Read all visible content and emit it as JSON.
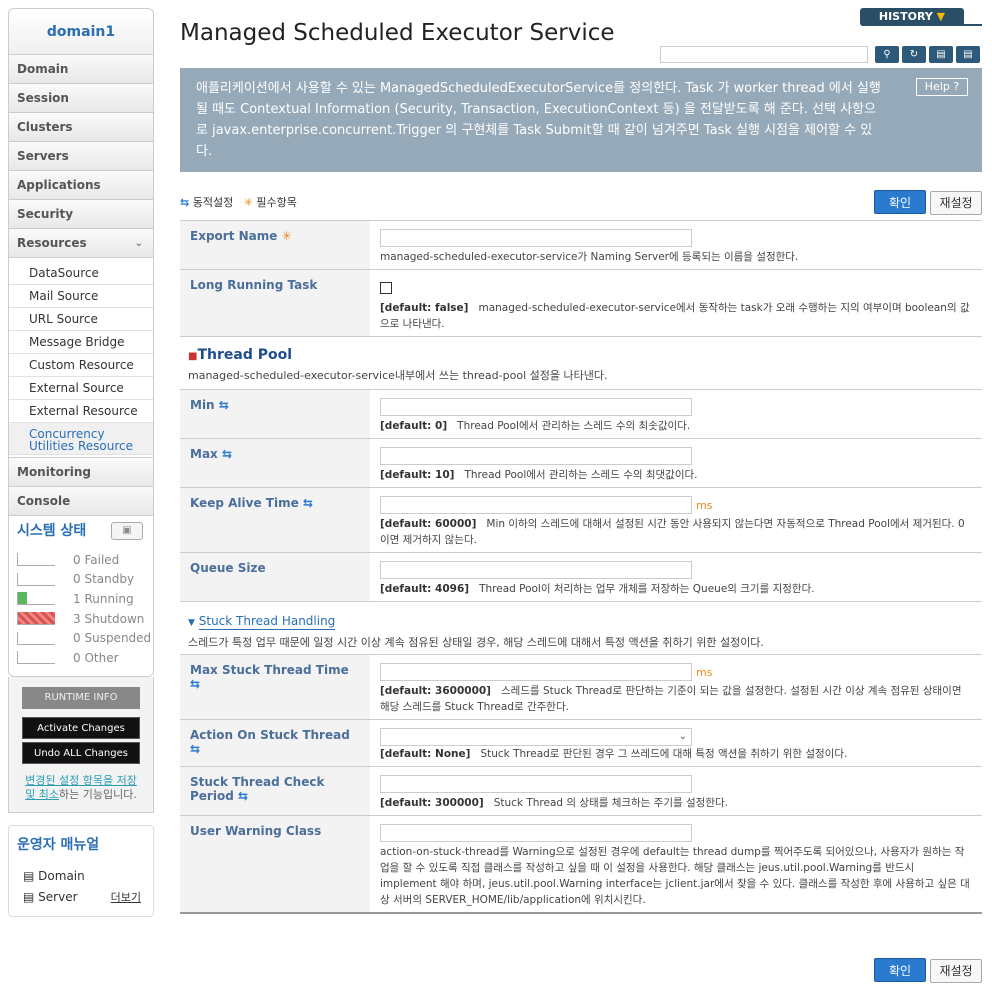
{
  "sidebar": {
    "domain": "domain1",
    "nav": [
      "Domain",
      "Session",
      "Clusters",
      "Servers",
      "Applications",
      "Security"
    ],
    "resources": "Resources",
    "sub": [
      "DataSource",
      "Mail Source",
      "URL Source",
      "Message Bridge",
      "Custom Resource",
      "External Source",
      "External Resource",
      "Concurrency Utilities Resource"
    ],
    "monitoring": "Monitoring",
    "console": "Console",
    "status_title": "시스템 상태",
    "status": [
      {
        "count": "0",
        "label": "Failed"
      },
      {
        "count": "0",
        "label": "Standby"
      },
      {
        "count": "1",
        "label": "Running"
      },
      {
        "count": "3",
        "label": "Shutdown"
      },
      {
        "count": "0",
        "label": "Suspended"
      },
      {
        "count": "0",
        "label": "Other"
      }
    ],
    "runtime_info": "RUNTIME INFO",
    "activate": "Activate Changes",
    "undo": "Undo ALL Changes",
    "note_link": "변경된 설정 항목을 저장 및 최소",
    "note_rest": "하는 기능입니다.",
    "manual_title": "운영자 매뉴얼",
    "manual_items": [
      "Domain",
      "Server"
    ],
    "more": "더보기"
  },
  "main": {
    "title": "Managed Scheduled Executor Service",
    "history": "HISTORY",
    "description": "애플리케이션에서 사용할 수 있는 ManagedScheduledExecutorService를 정의한다. Task 가 worker thread 에서 실행될 때도 Contextual Information (Security, Transaction, ExecutionContext 등) 을 전달받도록 해 준다. 선택 사항으로 javax.enterprise.concurrent.Trigger 의 구현체를 Task Submit할 때 같이 넘겨주면 Task 실행 시점을 제어할 수 있다.",
    "help": "Help",
    "legend_dynamic": "동적설정",
    "legend_required": "필수항목",
    "ok": "확인",
    "reset": "재설정"
  },
  "form": {
    "export_name": {
      "label": "Export Name",
      "desc": "managed-scheduled-executor-service가 Naming Server에 등록되는 이름을 설정한다."
    },
    "long_running": {
      "label": "Long Running Task",
      "default": "[default: false]",
      "desc": "managed-scheduled-executor-service에서 동작하는 task가 오래 수행하는 지의 여부이며 boolean의 값으로 나타낸다."
    },
    "thread_pool": {
      "title": "Thread Pool",
      "desc": "managed-scheduled-executor-service내부에서 쓰는 thread-pool 설정을 나타낸다."
    },
    "min": {
      "label": "Min",
      "default": "[default: 0]",
      "desc": "Thread Pool에서 관리하는 스레드 수의 최솟값이다."
    },
    "max": {
      "label": "Max",
      "default": "[default: 10]",
      "desc": "Thread Pool에서 관리하는 스레드 수의 최댓값이다."
    },
    "keep_alive": {
      "label": "Keep Alive Time",
      "unit": "ms",
      "default": "[default: 60000]",
      "desc": "Min 이하의 스레드에 대해서 설정된 시간 동안 사용되지 않는다면 자동적으로 Thread Pool에서 제거된다. 0이면 제거하지 않는다."
    },
    "queue": {
      "label": "Queue Size",
      "default": "[default: 4096]",
      "desc": "Thread Pool이 처리하는 업무 개체를 저장하는 Queue의 크기를 지정한다."
    },
    "stuck": {
      "title": "Stuck Thread Handling",
      "desc": "스레드가 특정 업무 때문에 일정 시간 이상 계속 점유된 상태일 경우, 해당 스레드에 대해서 특정 액션을 취하기 위한 설정이다."
    },
    "max_stuck": {
      "label": "Max Stuck Thread Time",
      "unit": "ms",
      "default": "[default: 3600000]",
      "desc": "스레드를 Stuck Thread로 판단하는 기준이 되는 값을 설정한다. 설정된 시간 이상 계속 점유된 상태이면 해당 스레드를 Stuck Thread로 간주한다."
    },
    "action": {
      "label": "Action On Stuck Thread",
      "default": "[default: None]",
      "desc": "Stuck Thread로 판단된 경우 그 쓰레드에 대해 특정 액션을 취하기 위한 설정이다."
    },
    "check": {
      "label": "Stuck Thread Check Period",
      "default": "[default: 300000]",
      "desc": "Stuck Thread 의 상태를 체크하는 주기를 설정한다."
    },
    "warning": {
      "label": "User Warning Class",
      "desc": "action-on-stuck-thread를 Warning으로 설정된 경우에 default는 thread dump를 찍어주도록 되어있으나, 사용자가 원하는 작업을 할 수 있도록 직접 클래스를 작성하고 싶을 때 이 설정을 사용한다. 해당 클래스는 jeus.util.pool.Warning를 반드시 implement 해야 하며, jeus.util.pool.Warning interface는 jclient.jar에서 찾을 수 있다. 클래스를 작성한 후에 사용하고 싶은 대상 서버의 SERVER_HOME/lib/application에 위치시킨다."
    }
  }
}
